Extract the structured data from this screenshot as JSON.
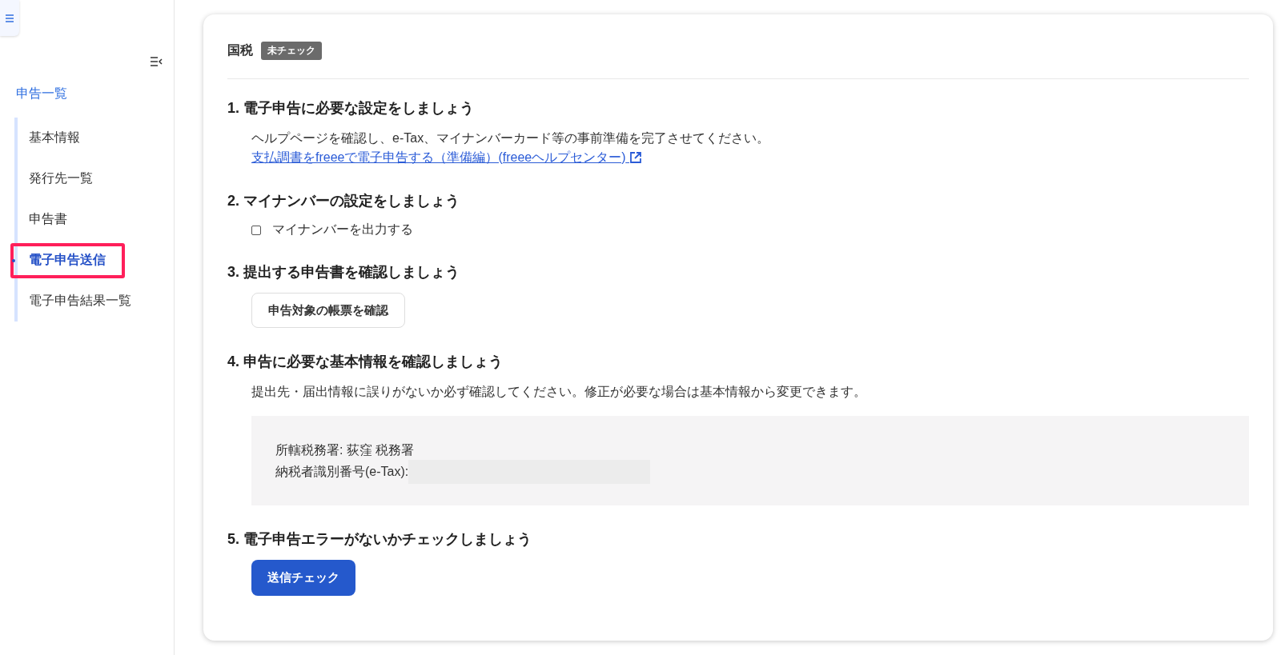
{
  "sidebar": {
    "parent_item": "申告一覧",
    "items": [
      {
        "label": "基本情報",
        "selected": false
      },
      {
        "label": "発行先一覧",
        "selected": false
      },
      {
        "label": "申告書",
        "selected": false
      },
      {
        "label": "電子申告送信",
        "selected": true
      },
      {
        "label": "電子申告結果一覧",
        "selected": false
      }
    ]
  },
  "card": {
    "title": "国税",
    "badge": "未チェック",
    "steps": [
      {
        "kind": "text",
        "heading": "1. 電子申告に必要な設定をしましょう",
        "description": "ヘルプページを確認し、e-Tax、マイナンバーカード等の事前準備を完了させてください。",
        "link": "支払調書をfreeeで電子申告する（準備編）(freeeヘルプセンター)"
      },
      {
        "kind": "checkbox",
        "heading": "2. マイナンバーの設定をしましょう",
        "checkbox": {
          "label": "マイナンバーを出力する",
          "checked": false
        }
      },
      {
        "kind": "button",
        "heading": "3. 提出する申告書を確認しましょう",
        "button": {
          "label": "申告対象の帳票を確認",
          "primary": false
        }
      },
      {
        "kind": "info",
        "heading": "4. 申告に必要な基本情報を確認しましょう",
        "description": "提出先・届出情報に誤りがないか必ず確認してください。修正が必要な場合は基本情報から変更できます。",
        "fields": [
          {
            "label": "所轄税務署: 荻窪 税務署",
            "masked": false
          },
          {
            "label": "納税者識別番号(e-Tax):",
            "masked": true
          }
        ]
      },
      {
        "kind": "button",
        "heading": "5. 電子申告エラーがないかチェックしましょう",
        "button": {
          "label": "送信チェック",
          "primary": true
        }
      }
    ]
  }
}
